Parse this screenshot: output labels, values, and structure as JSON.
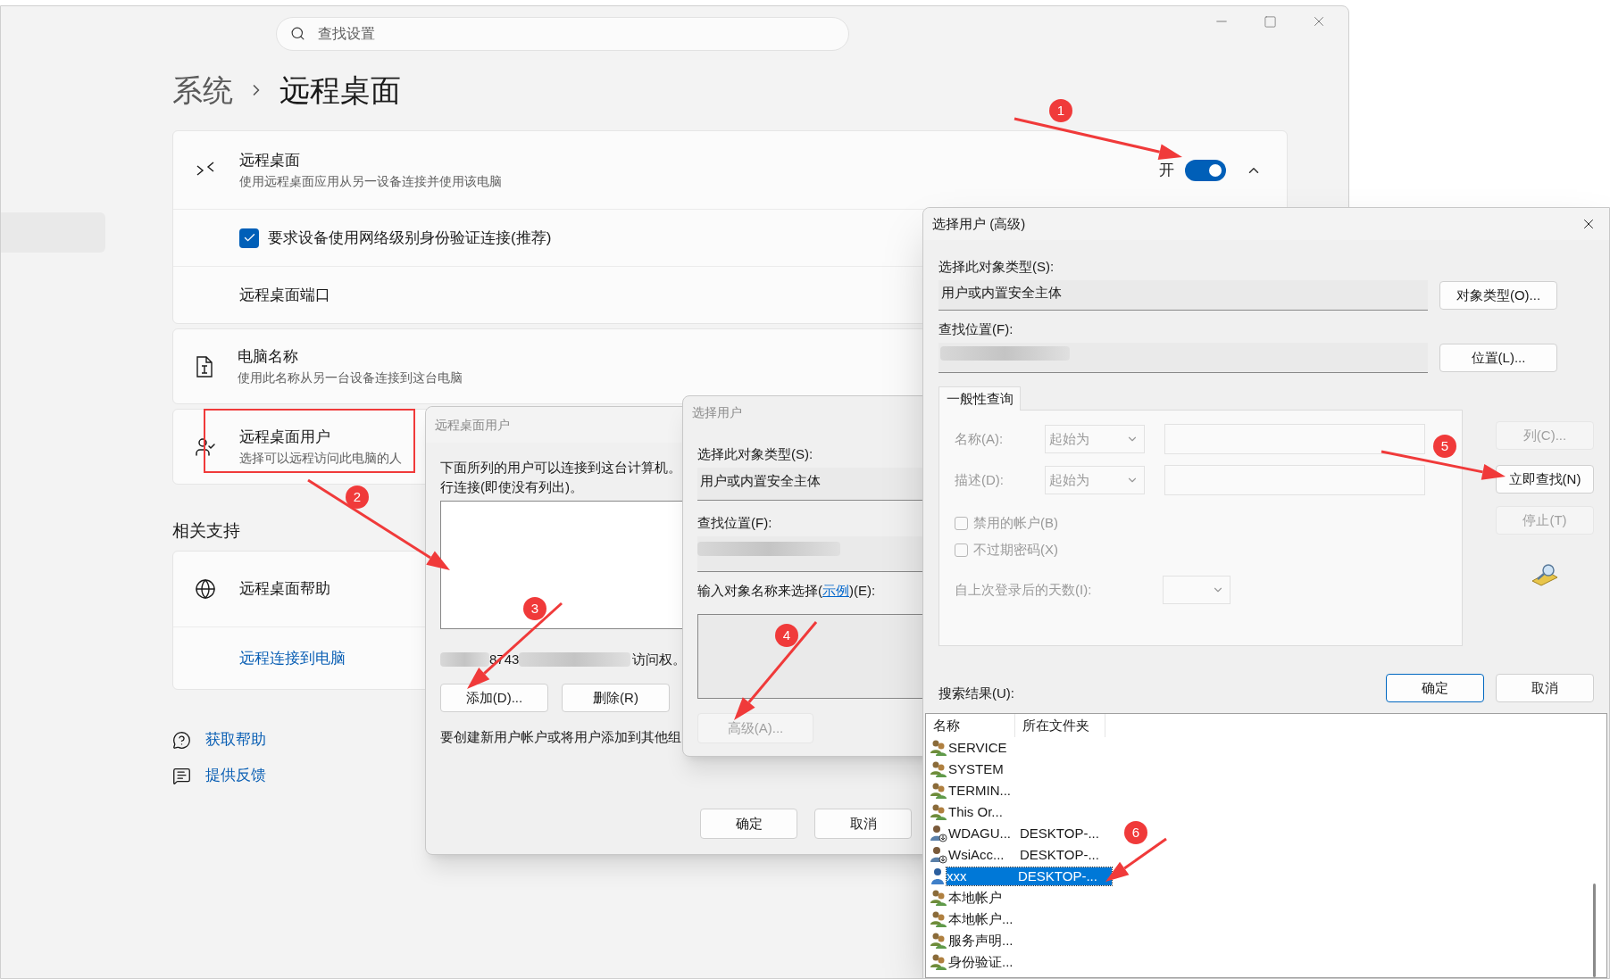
{
  "settings": {
    "search": {
      "placeholder": "查找设置"
    },
    "breadcrumb": {
      "parent": "系统",
      "current": "远程桌面"
    },
    "remote_desktop": {
      "title": "远程桌面",
      "description": "使用远程桌面应用从另一设备连接并使用该电脑",
      "state_label": "开",
      "on": true,
      "expanded": true
    },
    "nla": {
      "label": "要求设备使用网络级别身份验证连接(推荐)",
      "checked": true
    },
    "port": {
      "label": "远程桌面端口"
    },
    "pc_name": {
      "title": "电脑名称",
      "description": "使用此名称从另一台设备连接到这台电脑"
    },
    "users": {
      "title": "远程桌面用户",
      "description": "选择可以远程访问此电脑的人"
    },
    "related_heading": "相关支持",
    "help": {
      "title": "远程桌面帮助",
      "link": "远程连接到电脑"
    },
    "footer_links": [
      {
        "kind": "help",
        "label": "获取帮助"
      },
      {
        "kind": "feedback",
        "label": "提供反馈"
      }
    ]
  },
  "remote_users_dialog": {
    "title": "远程桌面用户",
    "intro_lines": [
      "下面所列的用户可以连接到这台计算机。",
      "行连接(即使没有列出)。"
    ],
    "membership_parts": [
      "8743",
      "访问权。"
    ],
    "buttons": [
      {
        "label": "添加(D)..."
      },
      {
        "label": "删除(R)"
      }
    ],
    "note": "要创建新用户帐户或将用户添加到其他组",
    "footer_buttons": [
      {
        "label": "确定"
      },
      {
        "label": "取消"
      }
    ]
  },
  "select_users_dialog": {
    "title": "选择用户",
    "object_type_label": "选择此对象类型(S):",
    "object_type": "用户或内置安全主体",
    "location_label": "查找位置(F):",
    "names_label_before": "输入对象名称来选择(",
    "names_link": "示例",
    "names_label_after": ")(E):",
    "advanced_button": {
      "label": "高级(A)...",
      "disabled": true
    }
  },
  "advanced_dialog": {
    "title": "选择用户 (高级)",
    "object_type_label": "选择此对象类型(S):",
    "object_type": "用户或内置安全主体",
    "object_type_button": "对象类型(O)...",
    "location_label": "查找位置(F):",
    "location_button": "位置(L)...",
    "query_tab": "一般性查询",
    "query_disabled": true,
    "name_label": "名称(A):",
    "name_mode": "起始为",
    "description_label": "描述(D):",
    "description_mode": "起始为",
    "checkboxes": [
      {
        "label": "禁用的帐户(B)",
        "checked": false
      },
      {
        "label": "不过期密码(X)",
        "checked": false
      }
    ],
    "days_label": "自上次登录后的天数(I):",
    "side_buttons": [
      {
        "label": "列(C)...",
        "disabled": true
      },
      {
        "label": "立即查找(N)",
        "disabled": false
      },
      {
        "label": "停止(T)",
        "disabled": true
      }
    ],
    "buttons": [
      {
        "label": "确定",
        "default": true
      },
      {
        "label": "取消",
        "default": false
      }
    ],
    "results_label": "搜索结果(U):",
    "columns": [
      "名称",
      "所在文件夹"
    ],
    "results": [
      {
        "kind": "group",
        "name": "SERVICE",
        "selected": false
      },
      {
        "kind": "group",
        "name": "SYSTEM",
        "selected": false
      },
      {
        "kind": "group",
        "name": "TERMIN...",
        "selected": false
      },
      {
        "kind": "group",
        "name": "This Or...",
        "selected": false
      },
      {
        "kind": "account",
        "name": "WDAGU...",
        "folder": "DESKTOP-...",
        "selected": false
      },
      {
        "kind": "account",
        "name": "WsiAcc...",
        "folder": "DESKTOP-...",
        "selected": false
      },
      {
        "kind": "user",
        "name": "xxx",
        "folder": "DESKTOP-...",
        "selected": true
      },
      {
        "kind": "group",
        "name": "本地帐户",
        "selected": false
      },
      {
        "kind": "group",
        "name": "本地帐户...",
        "selected": false
      },
      {
        "kind": "group",
        "name": "服务声明...",
        "selected": false
      },
      {
        "kind": "group",
        "name": "身份验证...",
        "selected": false
      }
    ]
  },
  "annotations": {
    "steps": [
      "1",
      "2",
      "3",
      "4",
      "5",
      "6"
    ]
  }
}
